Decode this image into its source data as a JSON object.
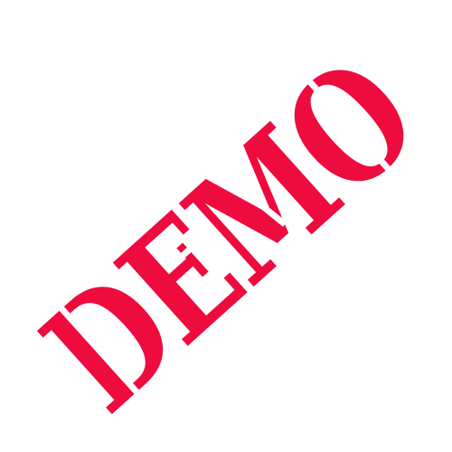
{
  "stamp": {
    "text": "DEMO",
    "color": "#EE0B3E"
  }
}
